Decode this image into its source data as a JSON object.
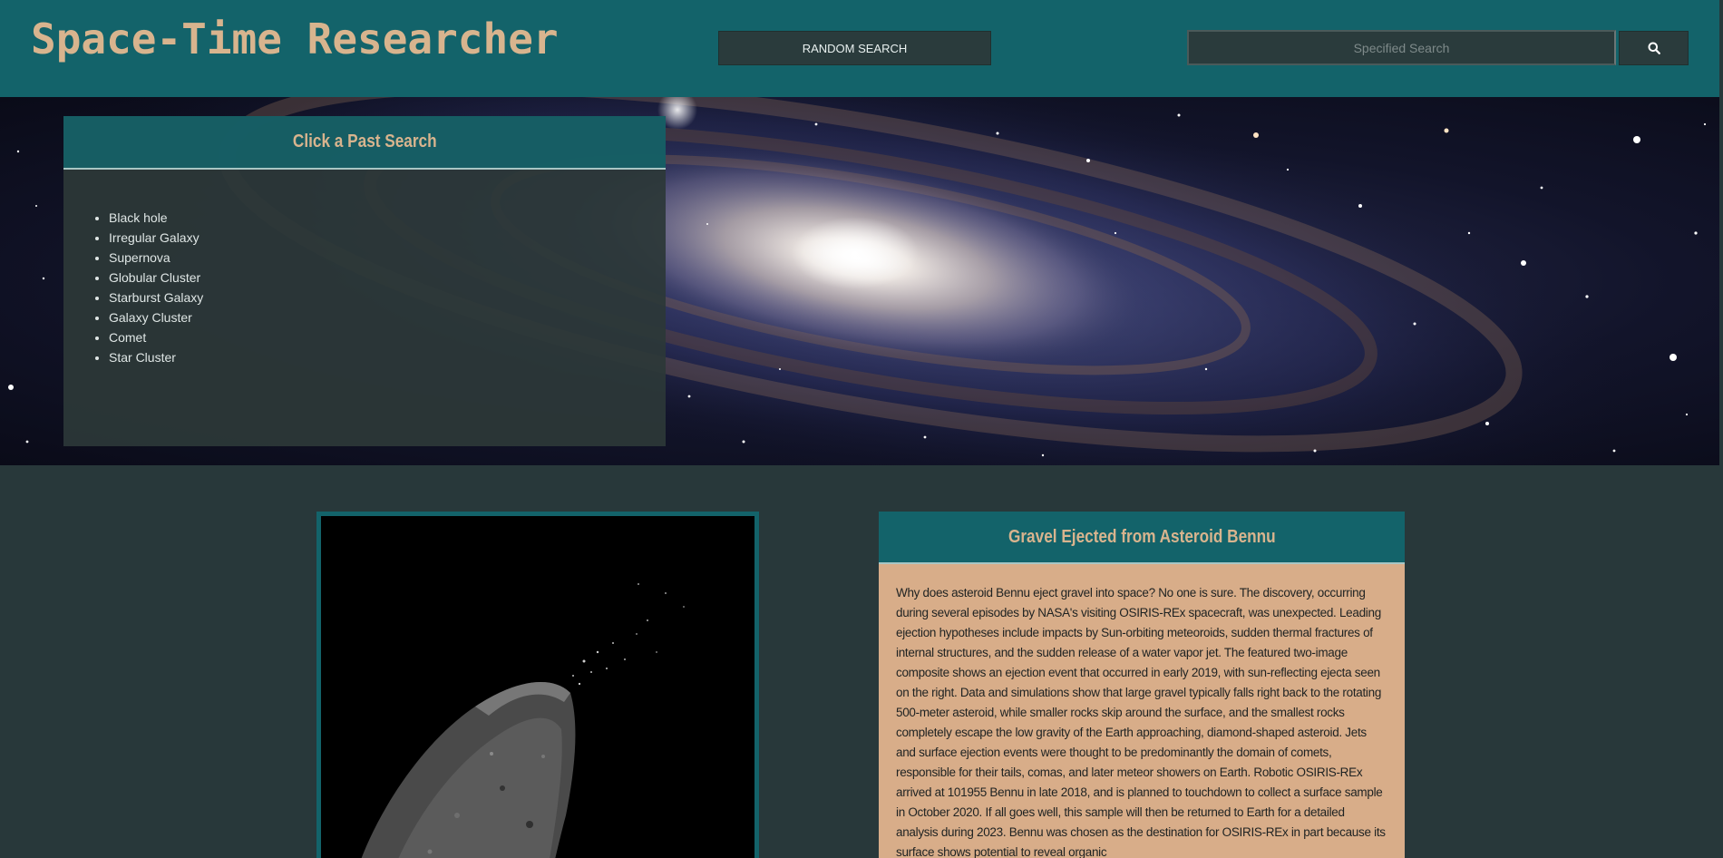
{
  "header": {
    "title": "Space-Time Researcher",
    "random_button_label": "RANDOM SEARCH",
    "search_placeholder": "Specified Search",
    "search_button_icon": "search-icon"
  },
  "past_searches": {
    "title": "Click a Past Search",
    "items": [
      "Black hole",
      "Irregular Galaxy",
      "Supernova",
      "Globular Cluster",
      "Starburst Galaxy",
      "Galaxy Cluster",
      "Comet",
      "Star Cluster"
    ]
  },
  "article": {
    "title": "Gravel Ejected from Asteroid Bennu",
    "body": "Why does asteroid Bennu eject gravel into space? No one is sure. The discovery, occurring during several episodes by NASA's visiting OSIRIS-REx spacecraft, was unexpected. Leading ejection hypotheses include impacts by Sun-orbiting meteoroids, sudden thermal fractures of internal structures, and the sudden release of a water vapor jet. The featured two-image composite shows an ejection event that occurred in early 2019, with sun-reflecting ejecta seen on the right. Data and simulations show that large gravel typically falls right back to the rotating 500-meter asteroid, while smaller rocks skip around the surface, and the smallest rocks completely escape the low gravity of the Earth approaching, diamond-shaped asteroid. Jets and surface ejection events were thought to be predominantly the domain of comets, responsible for their tails, comas, and later meteor showers on Earth. Robotic OSIRIS-REx arrived at 101955 Bennu in late 2018, and is planned to touchdown to collect a surface sample in October 2020. If all goes well, this sample will then be returned to Earth for a detailed analysis during 2023. Bennu was chosen as the destination for OSIRIS-REx in part because its surface shows potential to reveal organic"
  },
  "colors": {
    "header_bg": "#13636a",
    "page_bg": "#28383a",
    "title_tan": "#d8b48e",
    "article_bg": "#d8ad89"
  }
}
